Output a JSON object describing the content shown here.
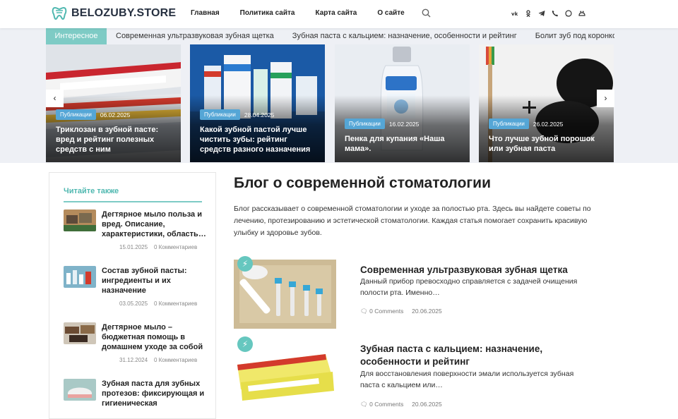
{
  "header": {
    "logo": "BELOZUBY.STORE",
    "nav": [
      "Главная",
      "Политика сайта",
      "Карта сайта",
      "О сайте"
    ],
    "social": [
      "vk-icon",
      "ok-icon",
      "telegram-icon",
      "viber-icon",
      "whatsapp-icon",
      "pinterest-icon"
    ],
    "brand_color": "#4fb8b0"
  },
  "ticker": {
    "label": "Интересное",
    "items": [
      "Современная ультразвуковая зубная щетка",
      "Зубная паста с кальцием: назначение, особенности и рейтинг",
      "Болит зуб под коронкой, ч"
    ]
  },
  "slides": [
    {
      "badge": "Публикации",
      "date": "06.02.2025",
      "title": "Триклозан в зубной пасте: вред и рейтинг полезных средств с ним"
    },
    {
      "badge": "Публикации",
      "date": "28.04.2025",
      "title": "Какой зубной пастой лучше чистить зубы: рейтинг средств разного назначения"
    },
    {
      "badge": "Публикации",
      "date": "16.02.2025",
      "title": "Пенка для купания «Наша мама»."
    },
    {
      "badge": "Публикации",
      "date": "26.02.2025",
      "title": "Что лучше зубной порошок или зубная паста"
    }
  ],
  "slider_controls": {
    "prev": "‹",
    "next": "›"
  },
  "sidebar": {
    "title": "Читайте также",
    "items": [
      {
        "title": "Дегтярное мыло польза и вред. Описание, характеристики, область…",
        "date": "15.01.2025",
        "comments": "0 Комментариев"
      },
      {
        "title": "Состав зубной пасты: ингредиенты и их назначение",
        "date": "03.05.2025",
        "comments": "0 Комментариев"
      },
      {
        "title": "Дегтярное мыло – бюджетная помощь в домашнем уходе за собой",
        "date": "31.12.2024",
        "comments": "0 Комментариев"
      },
      {
        "title": "Зубная паста для зубных протезов: фиксирующая и гигиеническая",
        "date": "",
        "comments": ""
      }
    ]
  },
  "main": {
    "title": "Блог о современной стоматологии",
    "description": "Блог рассказывает о современной стоматологии и уходе за полостью рта. Здесь вы найдете советы по лечению, протезированию и эстетической стоматологии. Каждая статья помогает сохранить красивую улыбку и здоровье зубов.",
    "posts": [
      {
        "title": "Современная ультразвуковая зубная щетка",
        "excerpt": "Данный прибор превосходно справляется с задачей очищения полости рта. Именно…",
        "comments": "0 Comments",
        "date": "20.06.2025"
      },
      {
        "title": "Зубная паста с кальцием: назначение, особенности и рейтинг",
        "excerpt": "Для восстановления поверхности эмали используется зубная паста с кальцием или…",
        "comments": "0 Comments",
        "date": "20.06.2025"
      }
    ]
  }
}
